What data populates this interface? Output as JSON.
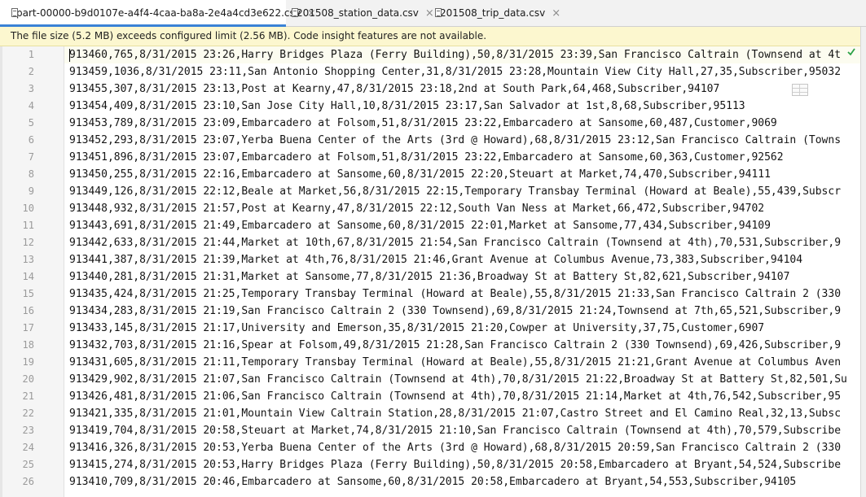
{
  "tabs": [
    {
      "label": "part-00000-b9d0107e-a4f4-4caa-ba8a-2e4a4cd3e622.csv",
      "close": "×",
      "active": true
    },
    {
      "label": "201508_station_data.csv",
      "close": "×",
      "active": false
    },
    {
      "label": "201508_trip_data.csv",
      "close": "×",
      "active": false
    }
  ],
  "banner": {
    "message": "The file size (5.2 MB) exceeds configured limit (2.56 MB). Code insight features are not available."
  },
  "editor": {
    "line_numbers": [
      "1",
      "2",
      "3",
      "4",
      "5",
      "6",
      "7",
      "8",
      "9",
      "10",
      "11",
      "12",
      "13",
      "14",
      "15",
      "16",
      "17",
      "18",
      "19",
      "20",
      "21",
      "22",
      "23",
      "24",
      "25",
      "26"
    ],
    "lines": [
      "913460,765,8/31/2015 23:26,Harry Bridges Plaza (Ferry Building),50,8/31/2015 23:39,San Francisco Caltrain (Townsend at 4t",
      "913459,1036,8/31/2015 23:11,San Antonio Shopping Center,31,8/31/2015 23:28,Mountain View City Hall,27,35,Subscriber,95032",
      "913455,307,8/31/2015 23:13,Post at Kearny,47,8/31/2015 23:18,2nd at South Park,64,468,Subscriber,94107",
      "913454,409,8/31/2015 23:10,San Jose City Hall,10,8/31/2015 23:17,San Salvador at 1st,8,68,Subscriber,95113",
      "913453,789,8/31/2015 23:09,Embarcadero at Folsom,51,8/31/2015 23:22,Embarcadero at Sansome,60,487,Customer,9069",
      "913452,293,8/31/2015 23:07,Yerba Buena Center of the Arts (3rd @ Howard),68,8/31/2015 23:12,San Francisco Caltrain (Towns",
      "913451,896,8/31/2015 23:07,Embarcadero at Folsom,51,8/31/2015 23:22,Embarcadero at Sansome,60,363,Customer,92562",
      "913450,255,8/31/2015 22:16,Embarcadero at Sansome,60,8/31/2015 22:20,Steuart at Market,74,470,Subscriber,94111",
      "913449,126,8/31/2015 22:12,Beale at Market,56,8/31/2015 22:15,Temporary Transbay Terminal (Howard at Beale),55,439,Subscr",
      "913448,932,8/31/2015 21:57,Post at Kearny,47,8/31/2015 22:12,South Van Ness at Market,66,472,Subscriber,94702",
      "913443,691,8/31/2015 21:49,Embarcadero at Sansome,60,8/31/2015 22:01,Market at Sansome,77,434,Subscriber,94109",
      "913442,633,8/31/2015 21:44,Market at 10th,67,8/31/2015 21:54,San Francisco Caltrain (Townsend at 4th),70,531,Subscriber,9",
      "913441,387,8/31/2015 21:39,Market at 4th,76,8/31/2015 21:46,Grant Avenue at Columbus Avenue,73,383,Subscriber,94104",
      "913440,281,8/31/2015 21:31,Market at Sansome,77,8/31/2015 21:36,Broadway St at Battery St,82,621,Subscriber,94107",
      "913435,424,8/31/2015 21:25,Temporary Transbay Terminal (Howard at Beale),55,8/31/2015 21:33,San Francisco Caltrain 2 (330",
      "913434,283,8/31/2015 21:19,San Francisco Caltrain 2 (330 Townsend),69,8/31/2015 21:24,Townsend at 7th,65,521,Subscriber,9",
      "913433,145,8/31/2015 21:17,University and Emerson,35,8/31/2015 21:20,Cowper at University,37,75,Customer,6907",
      "913432,703,8/31/2015 21:16,Spear at Folsom,49,8/31/2015 21:28,San Francisco Caltrain 2 (330 Townsend),69,426,Subscriber,9",
      "913431,605,8/31/2015 21:11,Temporary Transbay Terminal (Howard at Beale),55,8/31/2015 21:21,Grant Avenue at Columbus Aven",
      "913429,902,8/31/2015 21:07,San Francisco Caltrain (Townsend at 4th),70,8/31/2015 21:22,Broadway St at Battery St,82,501,Su",
      "913426,481,8/31/2015 21:06,San Francisco Caltrain (Townsend at 4th),70,8/31/2015 21:14,Market at 4th,76,542,Subscriber,95",
      "913421,335,8/31/2015 21:01,Mountain View Caltrain Station,28,8/31/2015 21:07,Castro Street and El Camino Real,32,13,Subsc",
      "913419,704,8/31/2015 20:58,Steuart at Market,74,8/31/2015 21:10,San Francisco Caltrain (Townsend at 4th),70,579,Subscribe",
      "913416,326,8/31/2015 20:53,Yerba Buena Center of the Arts (3rd @ Howard),68,8/31/2015 20:59,San Francisco Caltrain 2 (330",
      "913415,274,8/31/2015 20:53,Harry Bridges Plaza (Ferry Building),50,8/31/2015 20:58,Embarcadero at Bryant,54,524,Subscribe",
      "913410,709,8/31/2015 20:46,Embarcadero at Sansome,60,8/31/2015 20:58,Embarcadero at Bryant,54,553,Subscriber,94105"
    ]
  },
  "icons": {
    "file": "csv-file-icon",
    "status": "inspection-ok-icon",
    "table_view": "table-view-icon"
  },
  "colors": {
    "tab_active_underline": "#3b82d6",
    "banner_background": "#fcf7cf",
    "gutter_background": "#f5f5f5",
    "status_ok": "#2aa146"
  }
}
